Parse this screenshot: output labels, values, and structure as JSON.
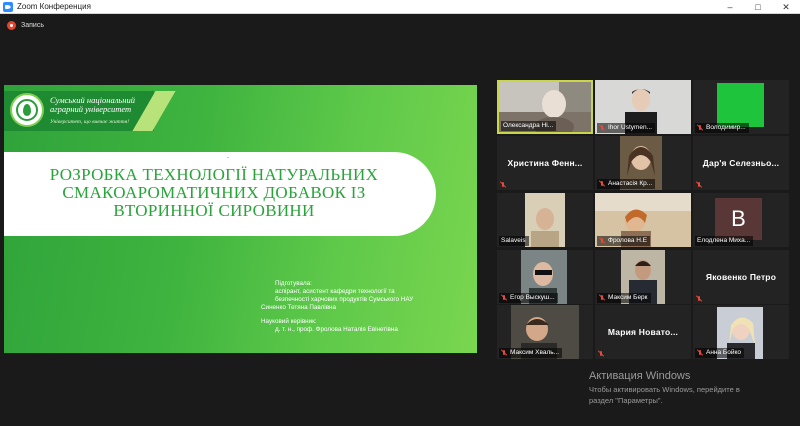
{
  "window": {
    "title": "Zoom Конференция",
    "controls": {
      "minimize": "–",
      "maximize": "□",
      "close": "✕"
    }
  },
  "recording": {
    "label": "Запись",
    "icon": "record-icon"
  },
  "slide": {
    "university_line1": "Сумський національний",
    "university_line2": "аграрний університет",
    "motto": "Університет, що вивчає життя!",
    "title_mark": "-",
    "title_line1": "РОЗРОБКА ТЕХНОЛОГІЇ НАТУРАЛЬНИХ",
    "title_line2": "СМАКОАРОМАТИЧНИХ ДОБАВОК ІЗ",
    "title_line3": "ВТОРИННОЇ СИРОВИНИ",
    "prepared_label": "Підготувала:",
    "prepared_line1": "аспірант, асистент кафедри технології та",
    "prepared_line2": "безпечності харчових продуктів Сумського НАУ",
    "prepared_name": "Синенко Тетяна Павлівна",
    "supervisor_label": "Науковий керівник:",
    "supervisor_line": "д. т. н., проф. Фролова Наталія Евінетівна"
  },
  "participants": [
    {
      "name": "Олександра Ні...",
      "muted": false,
      "view": "video",
      "active": true
    },
    {
      "name": "Ihor Ustymen...",
      "muted": true,
      "view": "video"
    },
    {
      "name": "Володимир...",
      "muted": true,
      "view": "green"
    },
    {
      "name": "Христина Фенн...",
      "muted": true,
      "view": "name"
    },
    {
      "name": "Анастасія Кр...",
      "muted": true,
      "view": "video"
    },
    {
      "name": "Дар'я Селезньо...",
      "muted": true,
      "view": "name"
    },
    {
      "name": "Salaveis",
      "muted": false,
      "view": "video"
    },
    {
      "name": "Фролова Н.Е",
      "muted": true,
      "view": "video"
    },
    {
      "name": "Елодлена Миха...",
      "muted": false,
      "view": "avatar",
      "avatar_letter": "B"
    },
    {
      "name": "Егор Выскуш...",
      "muted": true,
      "view": "video"
    },
    {
      "name": "Максим Берк",
      "muted": true,
      "view": "video"
    },
    {
      "name": "Яковенко Петро",
      "muted": true,
      "view": "name"
    },
    {
      "name": "Максим Хваль...",
      "muted": true,
      "view": "video"
    },
    {
      "name": "Мария Новато...",
      "muted": true,
      "view": "name"
    },
    {
      "name": "Анна Бойко",
      "muted": true,
      "view": "video"
    }
  ],
  "watermark": {
    "title": "Активация Windows",
    "line1": "Чтобы активировать Windows, перейдите в",
    "line2": "раздел \"Параметры\"."
  }
}
